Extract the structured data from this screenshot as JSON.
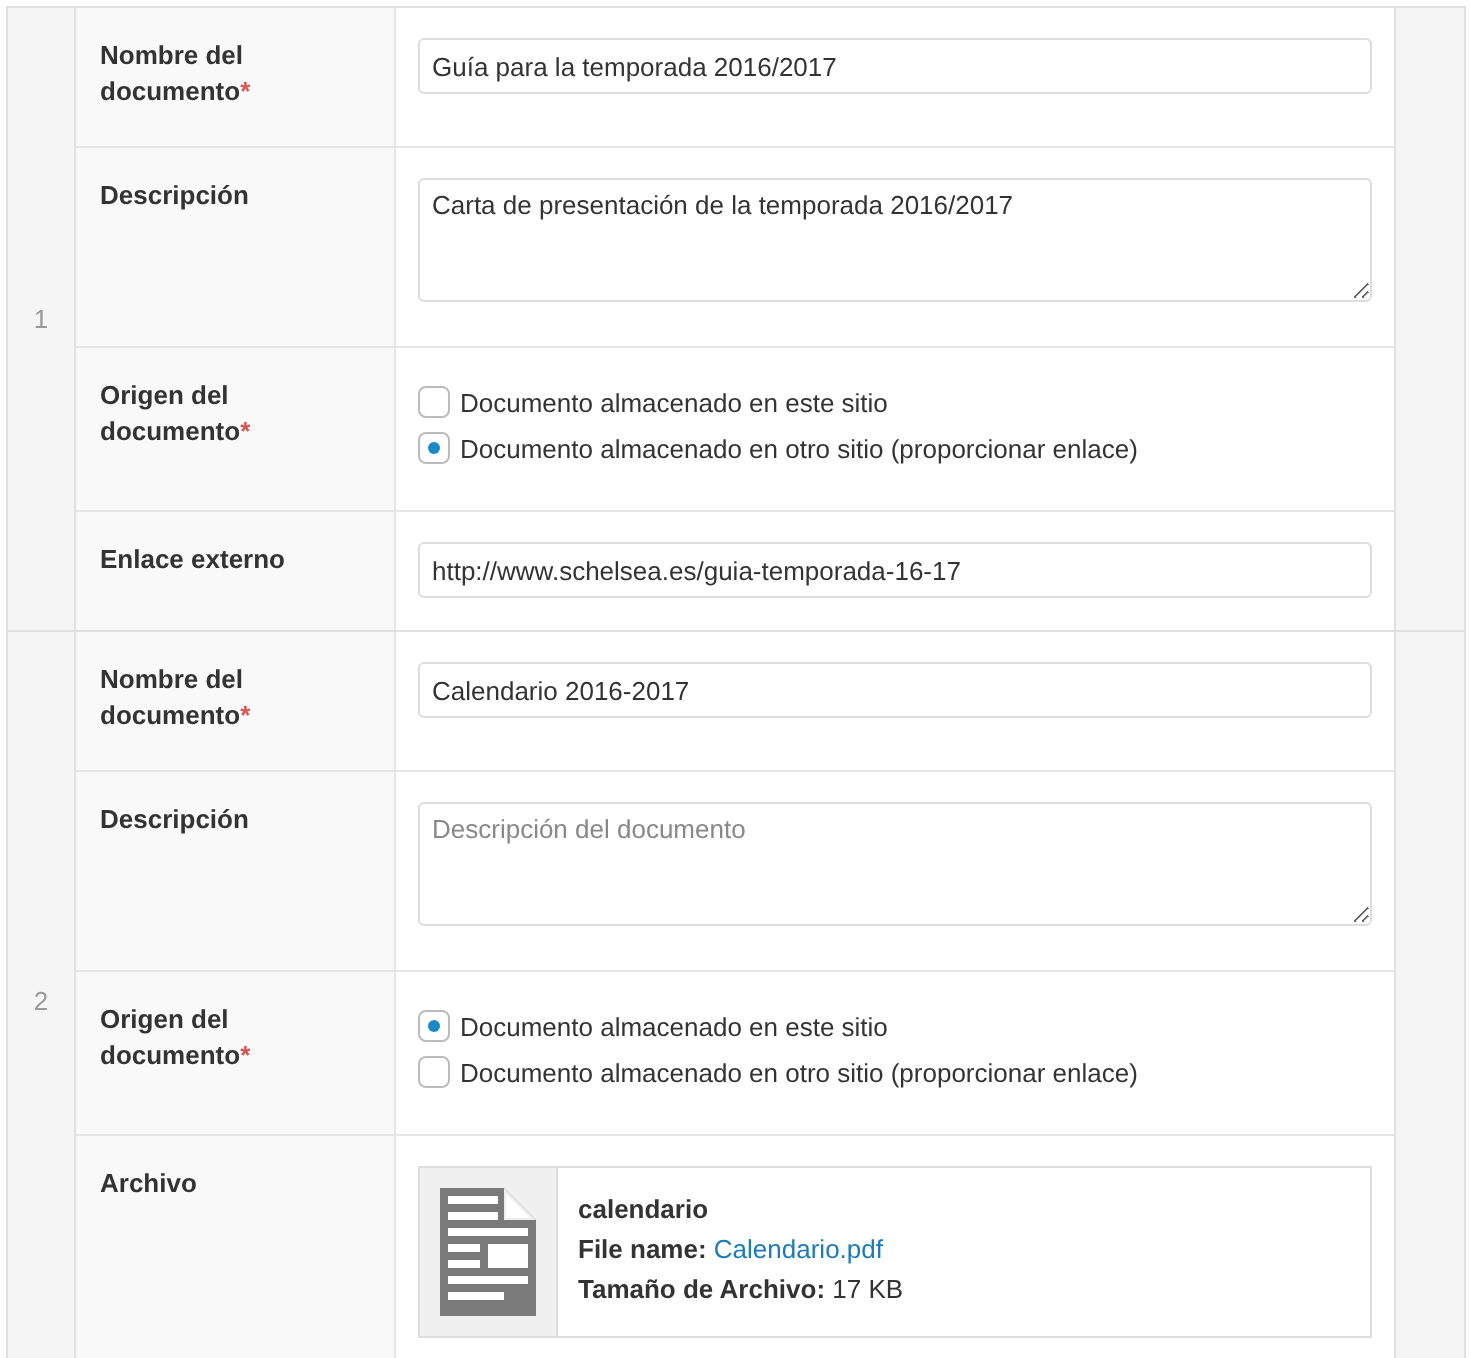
{
  "entries": [
    {
      "number": "1",
      "fields": [
        {
          "kind": "text",
          "label": "Nombre del documento",
          "required_mark": "*",
          "value": "Guía para la temporada 2016/2017"
        },
        {
          "kind": "textarea",
          "label": "Descripción",
          "value": "Carta de presentación de la temporada 2016/2017"
        },
        {
          "kind": "radio",
          "label": "Origen del documento",
          "required_mark": "*",
          "options": [
            {
              "label": "Documento almacenado en este sitio",
              "selected": false
            },
            {
              "label": "Documento almacenado en otro sitio (proporcionar enlace)",
              "selected": true
            }
          ]
        },
        {
          "kind": "text",
          "label": "Enlace externo",
          "value": "http://www.schelsea.es/guia-temporada-16-17"
        }
      ]
    },
    {
      "number": "2",
      "fields": [
        {
          "kind": "text",
          "label": "Nombre del documento",
          "required_mark": "*",
          "value": "Calendario 2016-2017"
        },
        {
          "kind": "textarea",
          "label": "Descripción",
          "placeholder": "Descripción del documento"
        },
        {
          "kind": "radio",
          "label": "Origen del documento",
          "required_mark": "*",
          "options": [
            {
              "label": "Documento almacenado en este sitio",
              "selected": true
            },
            {
              "label": "Documento almacenado en otro sitio (proporcionar enlace)",
              "selected": false
            }
          ]
        },
        {
          "kind": "file",
          "label": "Archivo",
          "title": "calendario",
          "name_label": "File name:",
          "file_name": "Calendario.pdf",
          "size_label": "Tamaño de Archivo:",
          "size": "17 KB"
        }
      ]
    }
  ]
}
